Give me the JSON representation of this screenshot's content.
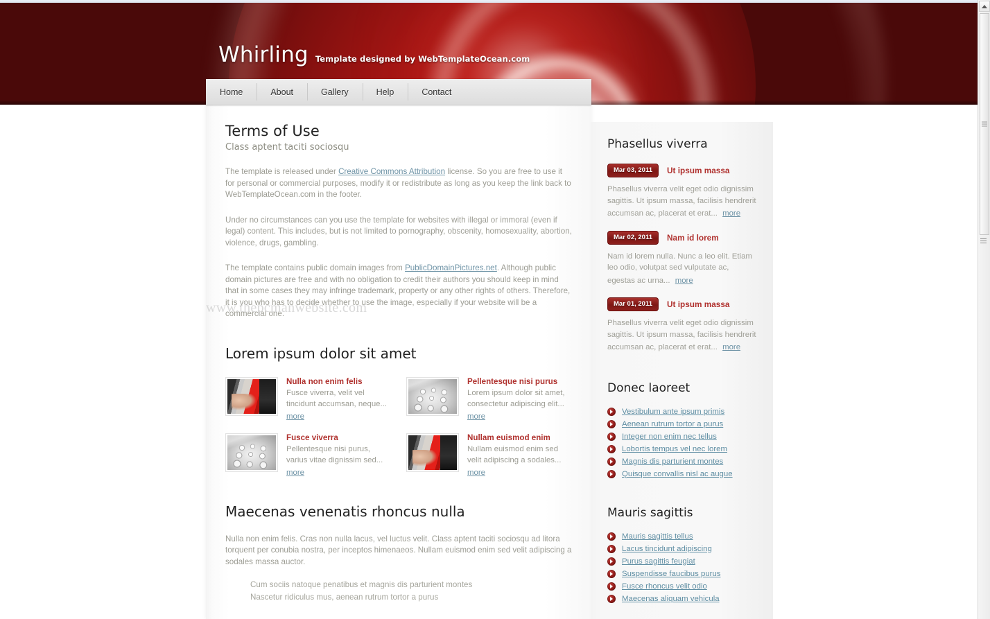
{
  "site": {
    "title": "Whirling",
    "tagline": "Template designed by WebTemplateOcean.com",
    "watermark": "www.thepcmanwebsite.com",
    "accent_red": "#b0322f",
    "header_dark": "#4a0909",
    "link_blue": "#6e93a6"
  },
  "nav": {
    "items": [
      {
        "label": "Home"
      },
      {
        "label": "About"
      },
      {
        "label": "Gallery"
      },
      {
        "label": "Help"
      },
      {
        "label": "Contact"
      }
    ]
  },
  "main": {
    "page_title": "Terms of Use",
    "page_subtitle": "Class aptent taciti sociosqu",
    "paragraphs": [
      {
        "before": "The template is released under ",
        "link": "Creative Commons Attribution",
        "after": " license. So you are free to use it for personal or commercial purposes, modify it or redistribute as long as you keep the link back to WebTemplateOcean.com in the footer."
      },
      {
        "before": "Under no circumstances can you use the template for websites with illegal or immoral (even if legal) content. This includes, but is not limited to pornography, obscenity, homosexuality, abortion, violence, drugs, gambling.",
        "link": "",
        "after": ""
      },
      {
        "before": "The template contains public domain images from ",
        "link": "PublicDomainPictures.net",
        "after": ". Although public domain pictures are free and with no obligation to credit their authors you should keep in mind that in some cases they may infringe trademark, property or any other rights of others. Therefore, it is you who has to decide whether to use the image, especially if your website will be a commercial one."
      }
    ],
    "teaser_section_title": "Lorem ipsum dolor sit amet",
    "more_label": "more",
    "teasers": [
      {
        "title": "Nulla non enim felis",
        "text": "Fusce viverra, velit vel tincidunt accumsan, neque...",
        "image": "photo-woman-laptop-red",
        "more": "more"
      },
      {
        "title": "Pellentesque nisi purus",
        "text": "Lorem ipsum dolor sit amet, consectetur adipiscing elit...",
        "image": "photo-phone-keypad",
        "more": "more"
      },
      {
        "title": "Fusce viverra",
        "text": "Pellentesque nisi purus, varius vitae dignissim sed...",
        "image": "photo-phone-keypad",
        "more": "more"
      },
      {
        "title": "Nullam euismod enim",
        "text": "Nullam euismod enim sed velit adipiscing a sodales...",
        "image": "photo-woman-laptop-red",
        "more": "more"
      }
    ],
    "bottom_section_title": "Maecenas venenatis rhoncus nulla",
    "bottom_paragraph": "Nulla non enim felis. Cras non nulla lacus, vel luctus velit. Class aptent taciti sociosqu ad litora torquent per conubia nostra, per inceptos himenaeos. Nullam euismod enim sed velit adipiscing a sodales massa auctor.",
    "bottom_list": [
      "Cum sociis natoque penatibus et magnis dis parturient montes",
      "Nascetur ridiculus mus, aenean rutrum tortor a purus"
    ]
  },
  "sidebar": {
    "news_title": "Phasellus viverra",
    "news": [
      {
        "date": "Mar 03, 2011",
        "title": "Ut ipsum massa",
        "text": "Phasellus viverra velit eget odio dignissim sagittis. Ut ipsum massa, facilisis hendrerit accumsan ac, placerat et erat...",
        "more": "more"
      },
      {
        "date": "Mar 02, 2011",
        "title": "Nam id lorem",
        "text": "Nam id lorem nulla. Nunc a leo elit. Etiam leo odio, volutpat sed vulputate ac, egestas ac urna...",
        "more": "more"
      },
      {
        "date": "Mar 01, 2011",
        "title": "Ut ipsum massa",
        "text": "Phasellus viverra velit eget odio dignissim sagittis. Ut ipsum massa, facilisis hendrerit accumsan ac, placerat et erat...",
        "more": "more"
      }
    ],
    "list_one_title": "Donec laoreet",
    "list_one": [
      "Vestibulum ante ipsum primis",
      "Aenean rutrum tortor a purus",
      "Integer non enim nec tellus",
      "Lobortis tempus vel nec lorem",
      "Magnis dis parturient montes",
      "Quisque convallis nisl ac augue"
    ],
    "list_two_title": "Mauris sagittis",
    "list_two": [
      "Mauris sagittis tellus",
      "Lacus tincidunt adipiscing",
      "Purus sagittis feugiat",
      "Suspendisse faucibus purus",
      "Fusce rhoncus velit odio",
      "Maecenas aliquam vehicula"
    ]
  }
}
